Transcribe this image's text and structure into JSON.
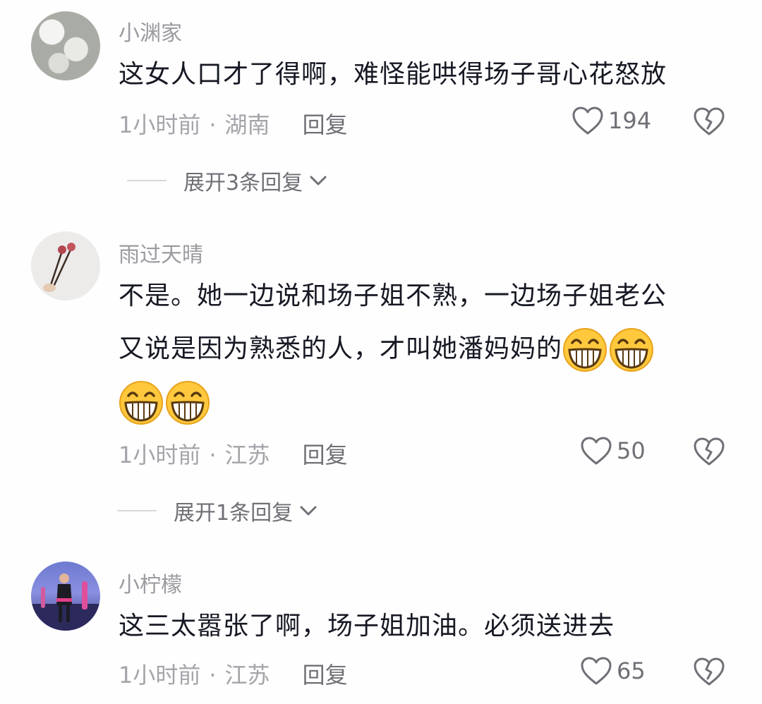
{
  "comments": [
    {
      "username": "小渊家",
      "text": "这女人口才了得啊，难怪能哄得场子哥心花怒放",
      "time": "1小时前",
      "separator": "·",
      "location": "湖南",
      "reply_label": "回复",
      "likes": "194",
      "expand_label": "展开3条回复"
    },
    {
      "username": "雨过天晴",
      "text_line1": "不是。她一边说和场子姐不熟，一边场子姐老公",
      "text_line2": "又说是因为熟悉的人，才叫她潘妈妈的",
      "emoji_name": "grinning-face-emoji",
      "emoji_count": 4,
      "time": "1小时前",
      "separator": "·",
      "location": "江苏",
      "reply_label": "回复",
      "likes": "50",
      "expand_label": "展开1条回复"
    },
    {
      "username": "小柠檬",
      "text": "这三太嚣张了啊，场子姐加油。必须送进去",
      "time": "1小时前",
      "separator": "·",
      "location": "江苏",
      "reply_label": "回复",
      "likes": "65"
    }
  ],
  "icons": {
    "like": "heart-outline-icon",
    "dislike": "broken-heart-icon",
    "expand": "chevron-down-icon"
  },
  "colors": {
    "text_primary": "#161823",
    "text_secondary": "#a4a4aa",
    "emoji_yellow": "#ffc83d"
  }
}
